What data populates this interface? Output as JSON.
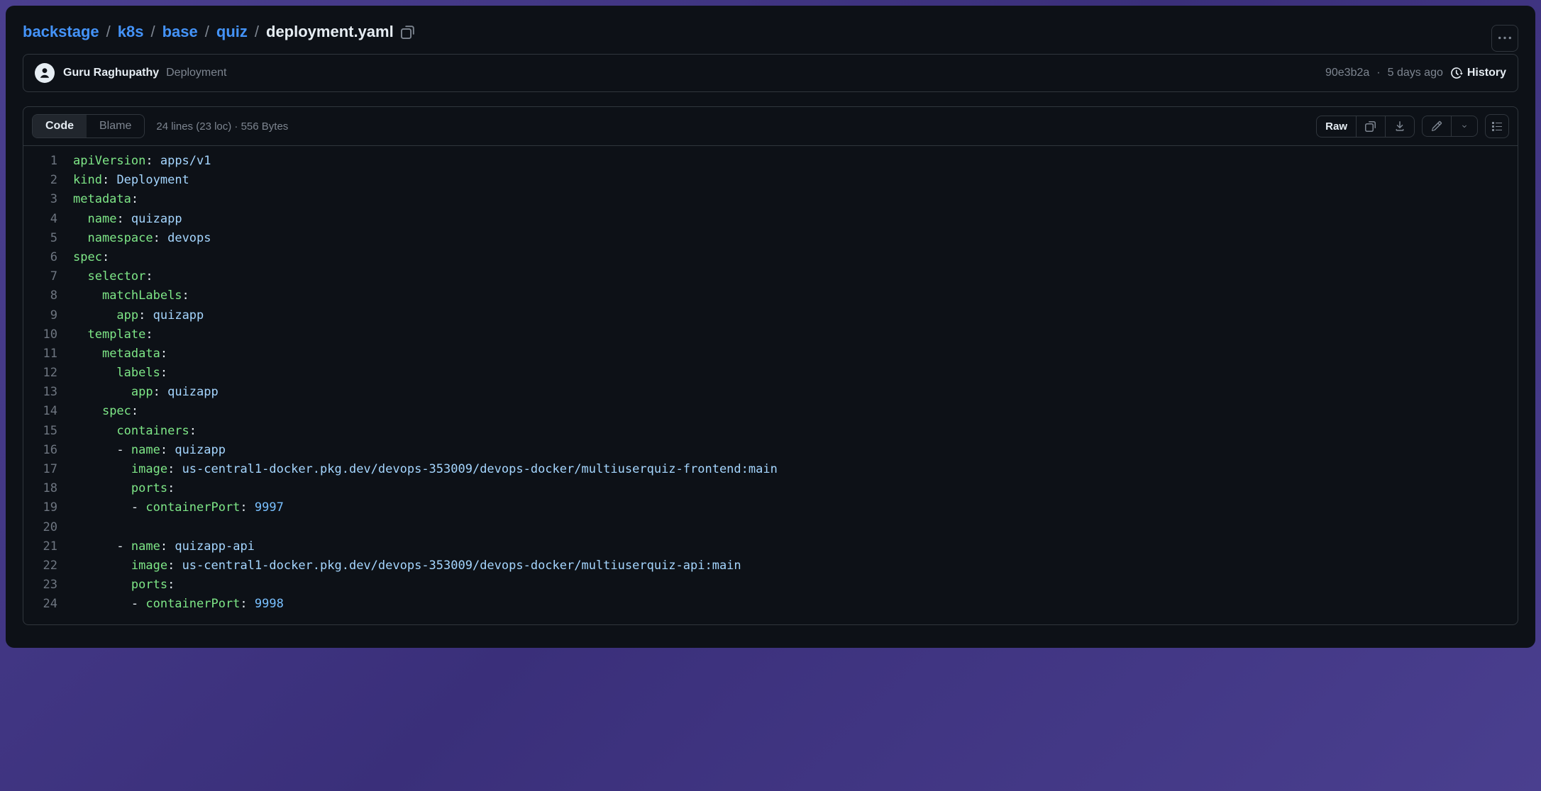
{
  "breadcrumb": {
    "parts": [
      "backstage",
      "k8s",
      "base",
      "quiz"
    ],
    "current": "deployment.yaml"
  },
  "author": {
    "name": "Guru Raghupathy",
    "commit_message": "Deployment",
    "sha": "90e3b2a",
    "when": "5 days ago",
    "history_label": "History"
  },
  "toolbar": {
    "code_tab": "Code",
    "blame_tab": "Blame",
    "file_meta": "24 lines (23 loc) · 556 Bytes",
    "raw_label": "Raw"
  },
  "code": {
    "line_count": 24,
    "lines": [
      [
        [
          "k",
          "apiVersion"
        ],
        [
          "p",
          ": "
        ],
        [
          "s",
          "apps/v1"
        ]
      ],
      [
        [
          "k",
          "kind"
        ],
        [
          "p",
          ": "
        ],
        [
          "s",
          "Deployment"
        ]
      ],
      [
        [
          "k",
          "metadata"
        ],
        [
          "p",
          ":"
        ]
      ],
      [
        [
          "d",
          "  "
        ],
        [
          "k",
          "name"
        ],
        [
          "p",
          ": "
        ],
        [
          "s",
          "quizapp"
        ]
      ],
      [
        [
          "d",
          "  "
        ],
        [
          "k",
          "namespace"
        ],
        [
          "p",
          ": "
        ],
        [
          "s",
          "devops"
        ]
      ],
      [
        [
          "k",
          "spec"
        ],
        [
          "p",
          ":"
        ]
      ],
      [
        [
          "d",
          "  "
        ],
        [
          "k",
          "selector"
        ],
        [
          "p",
          ":"
        ]
      ],
      [
        [
          "d",
          "    "
        ],
        [
          "k",
          "matchLabels"
        ],
        [
          "p",
          ":"
        ]
      ],
      [
        [
          "d",
          "      "
        ],
        [
          "k",
          "app"
        ],
        [
          "p",
          ": "
        ],
        [
          "s",
          "quizapp"
        ]
      ],
      [
        [
          "d",
          "  "
        ],
        [
          "k",
          "template"
        ],
        [
          "p",
          ":"
        ]
      ],
      [
        [
          "d",
          "    "
        ],
        [
          "k",
          "metadata"
        ],
        [
          "p",
          ":"
        ]
      ],
      [
        [
          "d",
          "      "
        ],
        [
          "k",
          "labels"
        ],
        [
          "p",
          ":"
        ]
      ],
      [
        [
          "d",
          "        "
        ],
        [
          "k",
          "app"
        ],
        [
          "p",
          ": "
        ],
        [
          "s",
          "quizapp"
        ]
      ],
      [
        [
          "d",
          "    "
        ],
        [
          "k",
          "spec"
        ],
        [
          "p",
          ":"
        ]
      ],
      [
        [
          "d",
          "      "
        ],
        [
          "k",
          "containers"
        ],
        [
          "p",
          ":"
        ]
      ],
      [
        [
          "d",
          "      - "
        ],
        [
          "k",
          "name"
        ],
        [
          "p",
          ": "
        ],
        [
          "s",
          "quizapp"
        ]
      ],
      [
        [
          "d",
          "        "
        ],
        [
          "k",
          "image"
        ],
        [
          "p",
          ": "
        ],
        [
          "s",
          "us-central1-docker.pkg.dev/devops-353009/devops-docker/multiuserquiz-frontend:main"
        ]
      ],
      [
        [
          "d",
          "        "
        ],
        [
          "k",
          "ports"
        ],
        [
          "p",
          ":"
        ]
      ],
      [
        [
          "d",
          "        - "
        ],
        [
          "k",
          "containerPort"
        ],
        [
          "p",
          ": "
        ],
        [
          "n",
          "9997"
        ]
      ],
      [],
      [
        [
          "d",
          "      - "
        ],
        [
          "k",
          "name"
        ],
        [
          "p",
          ": "
        ],
        [
          "s",
          "quizapp-api"
        ]
      ],
      [
        [
          "d",
          "        "
        ],
        [
          "k",
          "image"
        ],
        [
          "p",
          ": "
        ],
        [
          "s",
          "us-central1-docker.pkg.dev/devops-353009/devops-docker/multiuserquiz-api:main"
        ]
      ],
      [
        [
          "d",
          "        "
        ],
        [
          "k",
          "ports"
        ],
        [
          "p",
          ":"
        ]
      ],
      [
        [
          "d",
          "        - "
        ],
        [
          "k",
          "containerPort"
        ],
        [
          "p",
          ": "
        ],
        [
          "n",
          "9998"
        ]
      ]
    ]
  }
}
